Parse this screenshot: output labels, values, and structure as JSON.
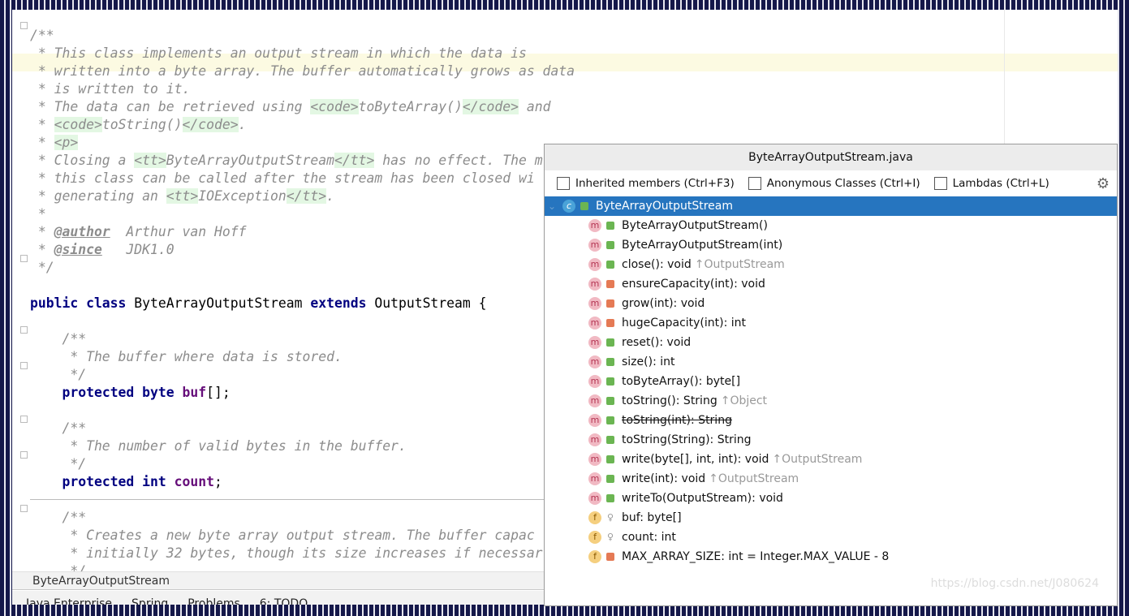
{
  "editor": {
    "lines": [
      [
        [
          "c",
          "/**"
        ]
      ],
      [
        [
          "c",
          " * This class implements an output stream in which the data is"
        ]
      ],
      [
        [
          "c",
          " * written into a byte array. The buffer automatically grows as data"
        ]
      ],
      [
        [
          "c",
          " * is written to it."
        ]
      ],
      [
        [
          "c",
          " * The data can be retrieved using "
        ],
        [
          "tag",
          "<code>"
        ],
        [
          "c",
          "toByteArray()"
        ],
        [
          "tag",
          "</code>"
        ],
        [
          "c",
          " and"
        ]
      ],
      [
        [
          "c",
          " * "
        ],
        [
          "tag",
          "<code>"
        ],
        [
          "c",
          "toString()"
        ],
        [
          "tag",
          "</code>"
        ],
        [
          "c",
          "."
        ]
      ],
      [
        [
          "c",
          " * "
        ],
        [
          "tag",
          "<p>"
        ]
      ],
      [
        [
          "c",
          " * Closing a "
        ],
        [
          "tag",
          "<tt>"
        ],
        [
          "c",
          "ByteArrayOutputStream"
        ],
        [
          "tag",
          "</tt>"
        ],
        [
          "c",
          " has no effect. The m"
        ]
      ],
      [
        [
          "c",
          " * this class can be called after the stream has been closed wi"
        ]
      ],
      [
        [
          "c",
          " * generating an "
        ],
        [
          "tag",
          "<tt>"
        ],
        [
          "c",
          "IOException"
        ],
        [
          "tag",
          "</tt>"
        ],
        [
          "c",
          "."
        ]
      ],
      [
        [
          "c",
          " *"
        ]
      ],
      [
        [
          "c",
          " * "
        ],
        [
          "doctag",
          "@author"
        ],
        [
          "c",
          "  Arthur van Hoff"
        ]
      ],
      [
        [
          "c",
          " * "
        ],
        [
          "doctag",
          "@since"
        ],
        [
          "c",
          "   JDK1.0"
        ]
      ],
      [
        [
          "c",
          " */"
        ]
      ],
      [],
      [
        [
          "kw",
          "public class "
        ],
        [
          "p",
          "ByteArrayOutputStream "
        ],
        [
          "kw",
          "extends "
        ],
        [
          "p",
          "OutputStream {"
        ]
      ],
      [],
      [
        [
          "c",
          "    /**"
        ]
      ],
      [
        [
          "c",
          "     * The buffer where data is stored."
        ]
      ],
      [
        [
          "c",
          "     */"
        ]
      ],
      [
        [
          "p",
          "    "
        ],
        [
          "kw",
          "protected byte "
        ],
        [
          "fld",
          "buf"
        ],
        [
          "p",
          "[];"
        ]
      ],
      [],
      [
        [
          "c",
          "    /**"
        ]
      ],
      [
        [
          "c",
          "     * The number of valid bytes in the buffer."
        ]
      ],
      [
        [
          "c",
          "     */"
        ]
      ],
      [
        [
          "p",
          "    "
        ],
        [
          "kw",
          "protected int "
        ],
        [
          "fld",
          "count"
        ],
        [
          "p",
          ";"
        ]
      ],
      [],
      [
        [
          "c",
          "    /**"
        ]
      ],
      [
        [
          "c",
          "     * Creates a new byte array output stream. The buffer capac"
        ]
      ],
      [
        [
          "c",
          "     * initially 32 bytes, though its size increases if necessar"
        ]
      ],
      [
        [
          "c",
          "     */"
        ]
      ]
    ]
  },
  "breadcrumb": "ByteArrayOutputStream",
  "toolbar": [
    "Java Enterprise",
    "Spring",
    "Problems",
    "6: TODO"
  ],
  "popup": {
    "title": "ByteArrayOutputStream.java",
    "options": [
      "Inherited members (Ctrl+F3)",
      "Anonymous Classes (Ctrl+I)",
      "Lambdas (Ctrl+L)"
    ],
    "root": "ByteArrayOutputStream",
    "members": [
      {
        "kind": "m",
        "vis": "public",
        "name": "ByteArrayOutputStream()"
      },
      {
        "kind": "m",
        "vis": "public",
        "name": "ByteArrayOutputStream(int)"
      },
      {
        "kind": "m",
        "vis": "public",
        "name": "close(): void",
        "inherited": "↑OutputStream"
      },
      {
        "kind": "m",
        "vis": "private",
        "name": "ensureCapacity(int): void"
      },
      {
        "kind": "m",
        "vis": "private",
        "name": "grow(int): void"
      },
      {
        "kind": "m",
        "vis": "private",
        "name": "hugeCapacity(int): int"
      },
      {
        "kind": "m",
        "vis": "public",
        "name": "reset(): void"
      },
      {
        "kind": "m",
        "vis": "public",
        "name": "size(): int"
      },
      {
        "kind": "m",
        "vis": "public",
        "name": "toByteArray(): byte[]"
      },
      {
        "kind": "m",
        "vis": "public",
        "name": "toString(): String",
        "inherited": "↑Object"
      },
      {
        "kind": "m",
        "vis": "public",
        "name": "toString(int): String",
        "deprecated": true
      },
      {
        "kind": "m",
        "vis": "public",
        "name": "toString(String): String"
      },
      {
        "kind": "m",
        "vis": "public",
        "name": "write(byte[], int, int): void",
        "inherited": "↑OutputStream"
      },
      {
        "kind": "m",
        "vis": "public",
        "name": "write(int): void",
        "inherited": "↑OutputStream"
      },
      {
        "kind": "m",
        "vis": "public",
        "name": "writeTo(OutputStream): void"
      },
      {
        "kind": "f",
        "vis": "package",
        "name": "buf: byte[]"
      },
      {
        "kind": "f",
        "vis": "package",
        "name": "count: int"
      },
      {
        "kind": "f",
        "vis": "private",
        "name": "MAX_ARRAY_SIZE: int = Integer.MAX_VALUE - 8"
      }
    ]
  },
  "watermark": "https://blog.csdn.net/J080624",
  "colors": {
    "selection": "#2675bf",
    "keyword": "#000080",
    "field": "#660e7a",
    "comment": "#8c8c8c"
  }
}
